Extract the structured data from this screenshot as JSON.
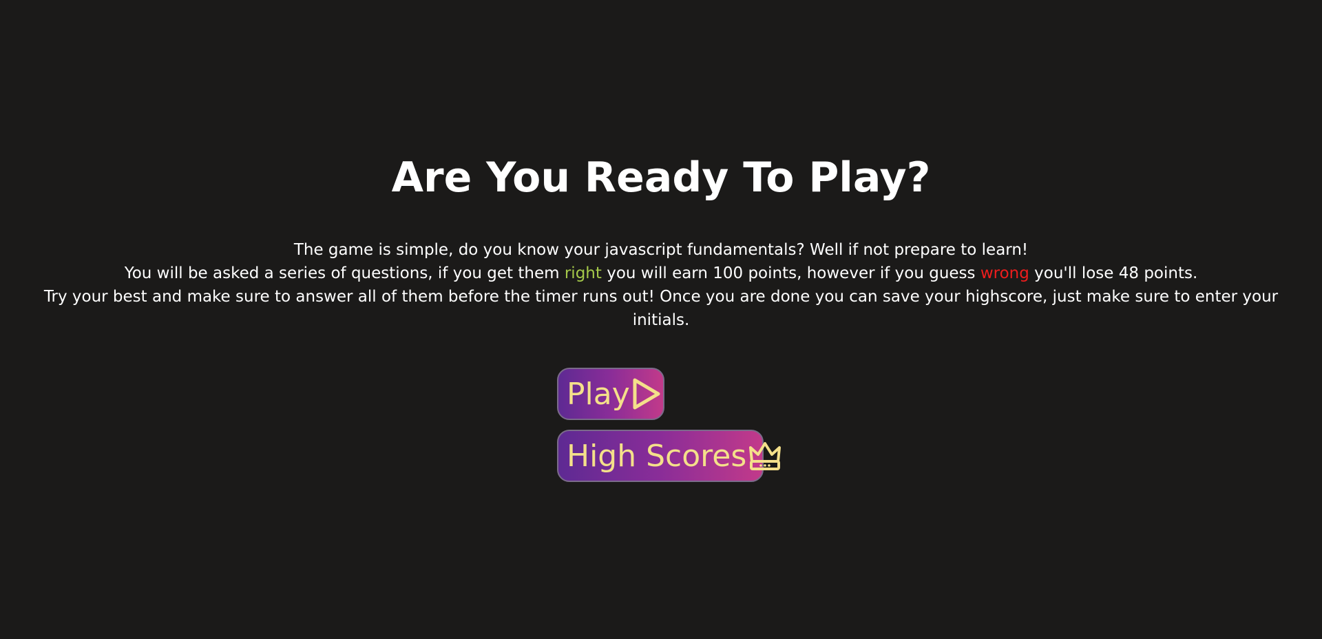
{
  "title": "Are You Ready To Play?",
  "intro": {
    "line1": "The game is simple, do you know your javascript fundamentals? Well if not prepare to learn!",
    "line2_before": "You will be asked a series of questions, if you get them ",
    "line2_right": "right",
    "line2_middle": " you will earn 100 points, however if you guess ",
    "line2_wrong": "wrong",
    "line2_after": " you'll lose 48 points.",
    "line3": "Try your best and make sure to answer all of them before the timer runs out! Once you are done you can save your highscore, just make sure to enter your initials."
  },
  "buttons": {
    "play_label": "Play",
    "play_icon": "play-icon",
    "scores_label": "High Scores",
    "scores_icon": "crown-icon"
  },
  "colors": {
    "background": "#1b1a19",
    "right_text": "#a5c94a",
    "wrong_text": "#ee1d1d",
    "button_text": "#f4e08a",
    "button_gradient_start": "#5e2a93",
    "button_gradient_end": "#c23a8a"
  }
}
